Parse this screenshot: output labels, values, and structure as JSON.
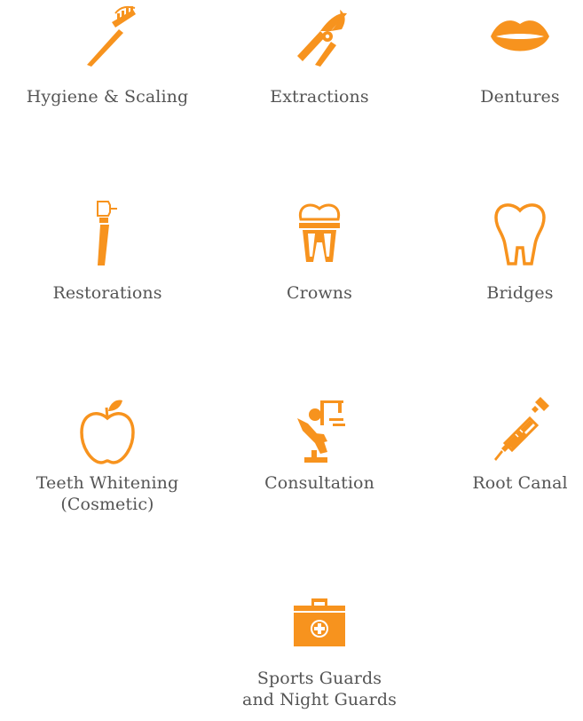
{
  "accent_color": "#F7931E",
  "services": [
    {
      "label": "Hygiene & Scaling",
      "icon": "toothbrush-icon"
    },
    {
      "label": "Extractions",
      "icon": "dental-pliers-icon"
    },
    {
      "label": "Dentures",
      "icon": "lips-icon"
    },
    {
      "label": "Restorations",
      "icon": "dental-drill-icon"
    },
    {
      "label": "Crowns",
      "icon": "tooth-crown-icon"
    },
    {
      "label": "Bridges",
      "icon": "tooth-icon"
    },
    {
      "label": "Teeth Whitening\n(Cosmetic)",
      "icon": "apple-icon"
    },
    {
      "label": "Consultation",
      "icon": "dental-chair-icon"
    },
    {
      "label": "Root Canal",
      "icon": "syringe-icon"
    },
    {
      "label": "Sports Guards\nand Night Guards",
      "icon": "first-aid-kit-icon"
    }
  ]
}
